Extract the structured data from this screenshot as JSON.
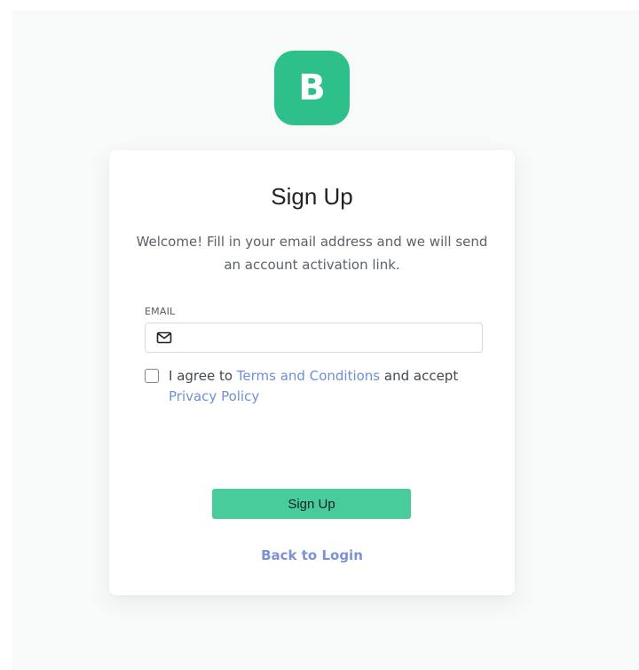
{
  "brand": {
    "logo_letter": "B",
    "color": "#2ec08a"
  },
  "signup_card": {
    "title": "Sign Up",
    "intro": "Welcome! Fill in your email address and we will send an account activation link.",
    "email": {
      "label": "EMAIL",
      "value": "",
      "placeholder": "",
      "icon": "envelope-icon"
    },
    "agreement": {
      "checked": false,
      "prefix": "I agree to ",
      "terms_link": "Terms and Conditions",
      "middle": " and accept ",
      "privacy_link": "Privacy Policy"
    },
    "submit_label": "Sign Up",
    "back_link": "Back to Login"
  },
  "colors": {
    "accent": "#48cc9b",
    "link": "#6f8fd6",
    "background": "#f8f9f9"
  }
}
